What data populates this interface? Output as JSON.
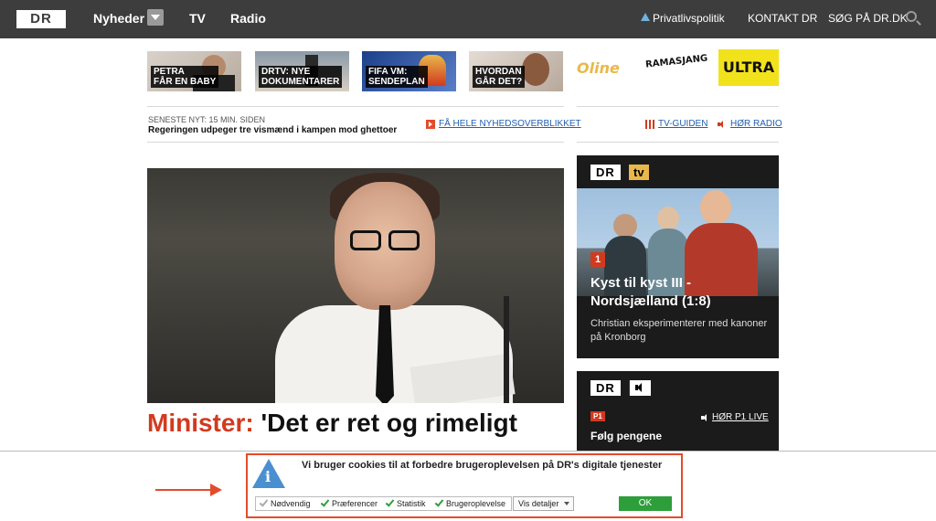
{
  "nav": {
    "logo": "DR",
    "items": [
      "Nyheder",
      "TV",
      "Radio"
    ],
    "privacy": "Privatlivspolitik",
    "contact": "KONTAKT DR",
    "search": "SØG PÅ DR.DK"
  },
  "tiles": [
    {
      "lines": [
        "PETRA",
        "FÅR EN BABY"
      ]
    },
    {
      "lines": [
        "DRTV: NYE",
        "DOKUMENTARER"
      ]
    },
    {
      "lines": [
        "FIFA VM:",
        "SENDEPLAN"
      ]
    },
    {
      "lines": [
        "HVORDAN",
        "GÅR DET?"
      ]
    }
  ],
  "brands": [
    "Oline",
    "RAMASJANG",
    "ULTRA"
  ],
  "latest": {
    "kicker": "SENESTE NYT: 15 MIN. SIDEN",
    "headline": "Regeringen udpeger tre vismænd i kampen mod ghettoer",
    "all_news": "FÅ HELE NYHEDSOVERBLIKKET",
    "tv_guide": "TV-GUIDEN",
    "radio": "HØR RADIO"
  },
  "hero": {
    "kicker": "Minister:",
    "title": " 'Det er ret og rimeligt"
  },
  "tv_card": {
    "badge": "DR",
    "badge2": "tv",
    "channel": "1",
    "title": "Kyst til kyst III - Nordsjælland (1:8)",
    "desc": "Christian eksperimenterer med kanoner på Kronborg"
  },
  "radio_card": {
    "badge": "DR",
    "station": "P1",
    "live": "HØR P1 LIVE",
    "show": "Følg pengene"
  },
  "cookie": {
    "text": "Vi bruger cookies til at forbedre brugeroplevelsen på DR's digitale tjenester",
    "options": [
      "Nødvendig",
      "Præferencer",
      "Statistik",
      "Brugeroplevelse"
    ],
    "details": "Vis detaljer",
    "ok": "OK"
  },
  "colors": {
    "accent": "#d23a1f",
    "nav_bg": "#3d3d3d",
    "ok_green": "#2e9e3b",
    "link": "#2060b0"
  }
}
